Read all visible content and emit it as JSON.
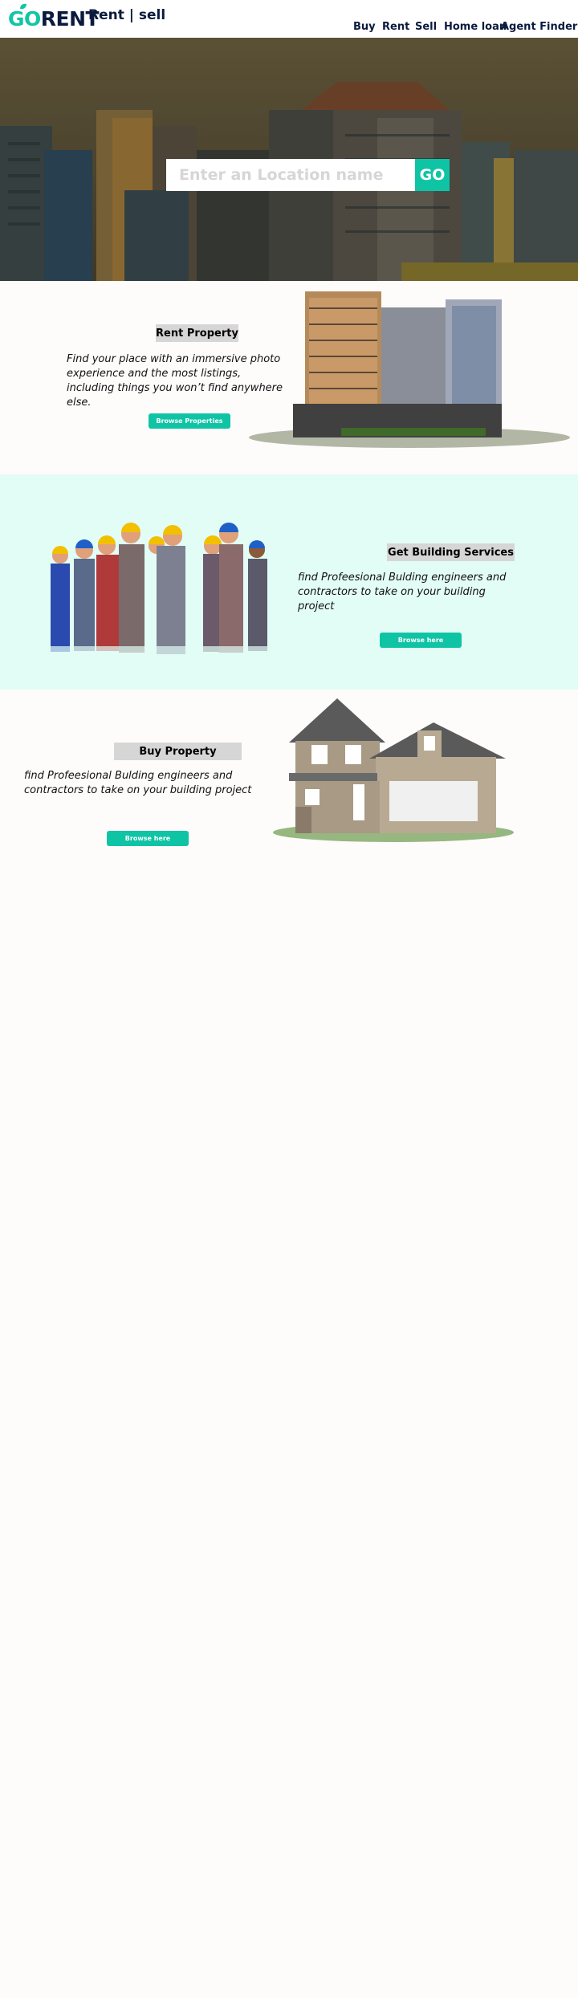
{
  "brand": {
    "logo_go": "GO",
    "logo_rent": "RENT",
    "tagline": "Rent  |   sell"
  },
  "nav": [
    {
      "label": "Buy"
    },
    {
      "label": "Rent"
    },
    {
      "label": "Sell"
    },
    {
      "label": "Home loan"
    },
    {
      "label": "Agent Finder"
    }
  ],
  "hero": {
    "search_placeholder": "Enter an Location name",
    "go_label": "GO"
  },
  "rent": {
    "title": "Rent Property",
    "description": "Find your place with an immersive photo experience and the most listings, including things you won’t find anywhere else.",
    "button": "Browse Properties"
  },
  "services": {
    "title": "Get  Building Services",
    "description": "find Profeesional Bulding engineers and contractors to take on your building project",
    "button": "Browse here"
  },
  "buy": {
    "title": "Buy  Property",
    "description": "find Profeesional Bulding engineers and contractors to take on your building project",
    "button": "Browse here"
  },
  "colors": {
    "accent": "#0fc4a4",
    "navy": "#0b1b3f",
    "mint_bg": "#e2fcf6",
    "label_bg": "#d6d6d6"
  }
}
